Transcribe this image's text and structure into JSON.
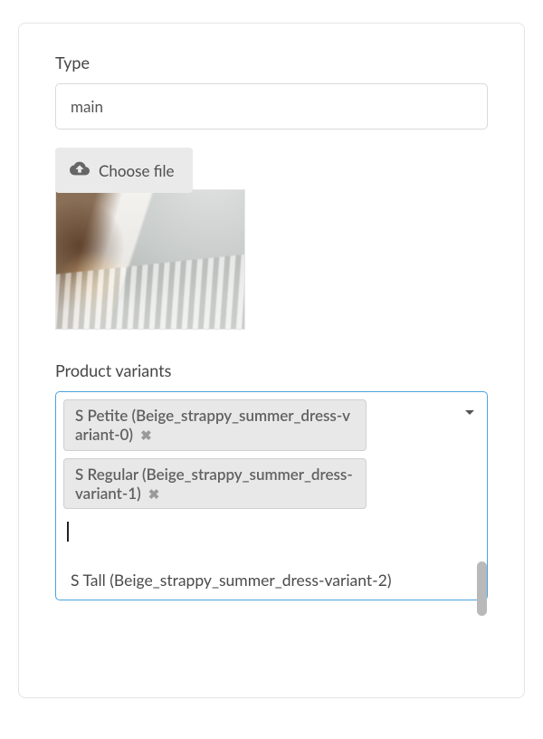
{
  "type_field": {
    "label": "Type",
    "value": "main"
  },
  "file_button": {
    "label": "Choose file"
  },
  "variants": {
    "label": "Product variants",
    "selected": [
      {
        "text": "S Petite (Beige_strappy_summer_dress-variant-0)"
      },
      {
        "text": "S Regular (Beige_strappy_summer_dress-variant-1)"
      }
    ],
    "dropdown_option": "S Tall (Beige_strappy_summer_dress-variant-2)"
  }
}
